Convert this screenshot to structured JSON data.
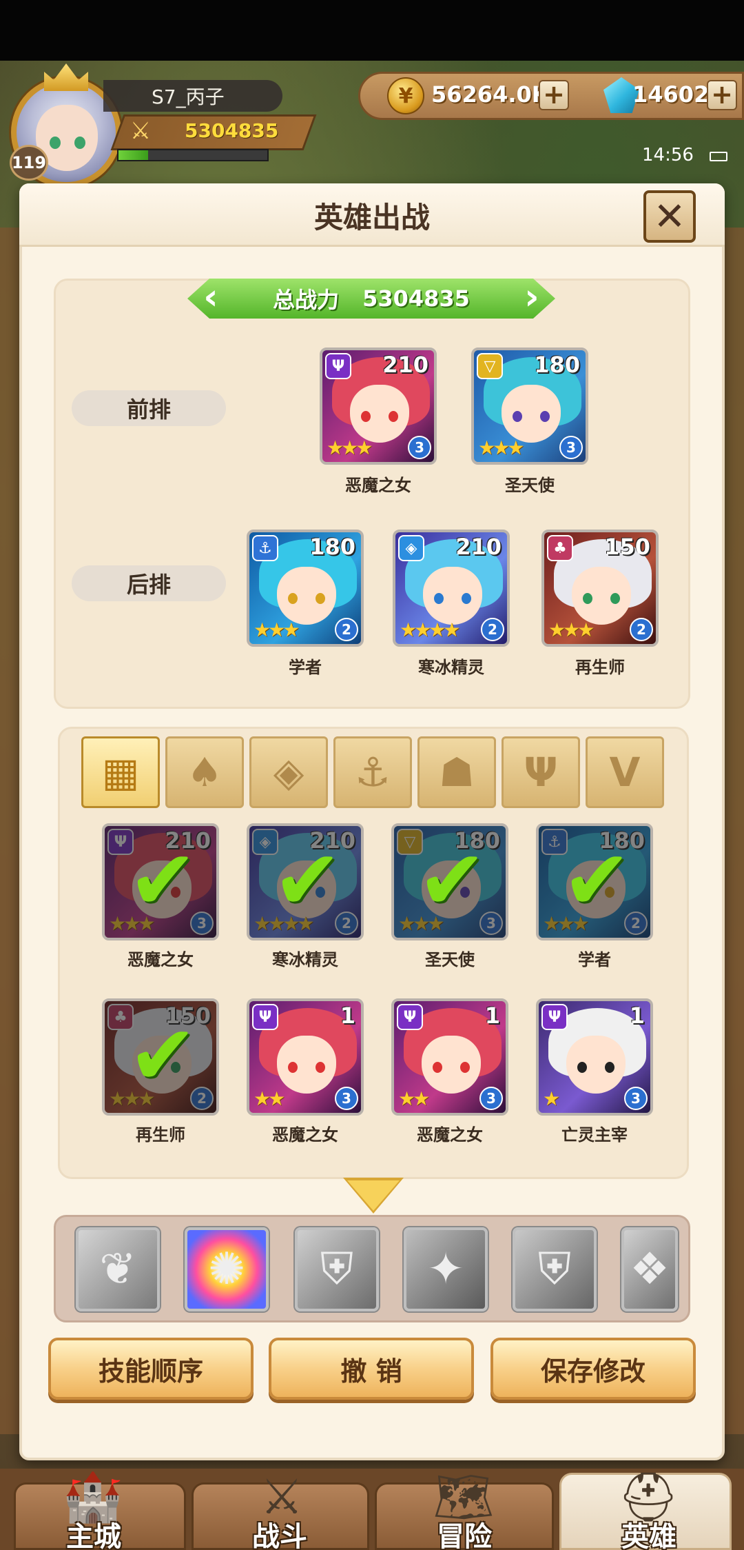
{
  "player": {
    "name": "S7_丙子",
    "level": "119",
    "power": "5304835",
    "exp_fraction": 0.2
  },
  "resources": {
    "gold": "56264.0K",
    "gems": "14602"
  },
  "status": {
    "time": "14:56"
  },
  "dialog": {
    "title": "英雄出战",
    "close_label": "✕",
    "total_power_label": "总战力",
    "total_power_value": "5304835"
  },
  "rows": {
    "front_label": "前排",
    "back_label": "后排"
  },
  "front_row": [
    {
      "name": "恶魔之女",
      "level": "210",
      "stars": "★★★",
      "rank": "3",
      "faction": "demon"
    },
    {
      "name": "圣天使",
      "level": "180",
      "stars": "★★★",
      "rank": "3",
      "faction": "holy"
    }
  ],
  "back_row": [
    {
      "name": "学者",
      "level": "180",
      "stars": "★★★",
      "rank": "2",
      "faction": "anchor"
    },
    {
      "name": "寒冰精灵",
      "level": "210",
      "stars": "★★★★",
      "rank": "2",
      "faction": "ice"
    },
    {
      "name": "再生师",
      "level": "150",
      "stars": "★★★",
      "rank": "2",
      "faction": "nature"
    }
  ],
  "filter_tabs": [
    {
      "icon": "grid-icon",
      "active": true
    },
    {
      "icon": "leaf-icon",
      "active": false
    },
    {
      "icon": "diamond-icon",
      "active": false
    },
    {
      "icon": "anchor-icon",
      "active": false
    },
    {
      "icon": "beast-icon",
      "active": false
    },
    {
      "icon": "demon-icon",
      "active": false
    },
    {
      "icon": "wing-icon",
      "active": false
    }
  ],
  "pool": [
    {
      "name": "恶魔之女",
      "level": "210",
      "stars": "★★★",
      "rank": "3",
      "selected": true
    },
    {
      "name": "寒冰精灵",
      "level": "210",
      "stars": "★★★★",
      "rank": "2",
      "selected": true
    },
    {
      "name": "圣天使",
      "level": "180",
      "stars": "★★★",
      "rank": "3",
      "selected": true
    },
    {
      "name": "学者",
      "level": "180",
      "stars": "★★★",
      "rank": "2",
      "selected": true
    },
    {
      "name": "再生师",
      "level": "150",
      "stars": "★★★",
      "rank": "2",
      "selected": true
    },
    {
      "name": "恶魔之女",
      "level": "1",
      "stars": "★★",
      "rank": "3",
      "selected": false
    },
    {
      "name": "恶魔之女",
      "level": "1",
      "stars": "★★",
      "rank": "3",
      "selected": false
    },
    {
      "name": "亡灵主宰",
      "level": "1",
      "stars": "★",
      "rank": "3",
      "selected": false
    }
  ],
  "buttons": {
    "skill_order": "技能顺序",
    "undo": "撤 销",
    "save": "保存修改"
  },
  "nav": {
    "city": "主城",
    "battle": "战斗",
    "adventure": "冒险",
    "hero": "英雄"
  },
  "colors": {
    "dialog_bg": "#fbf3e4",
    "panel_bg": "#f5e8d2",
    "green_banner": "#54b52a",
    "button_orange": "#f8d089"
  }
}
